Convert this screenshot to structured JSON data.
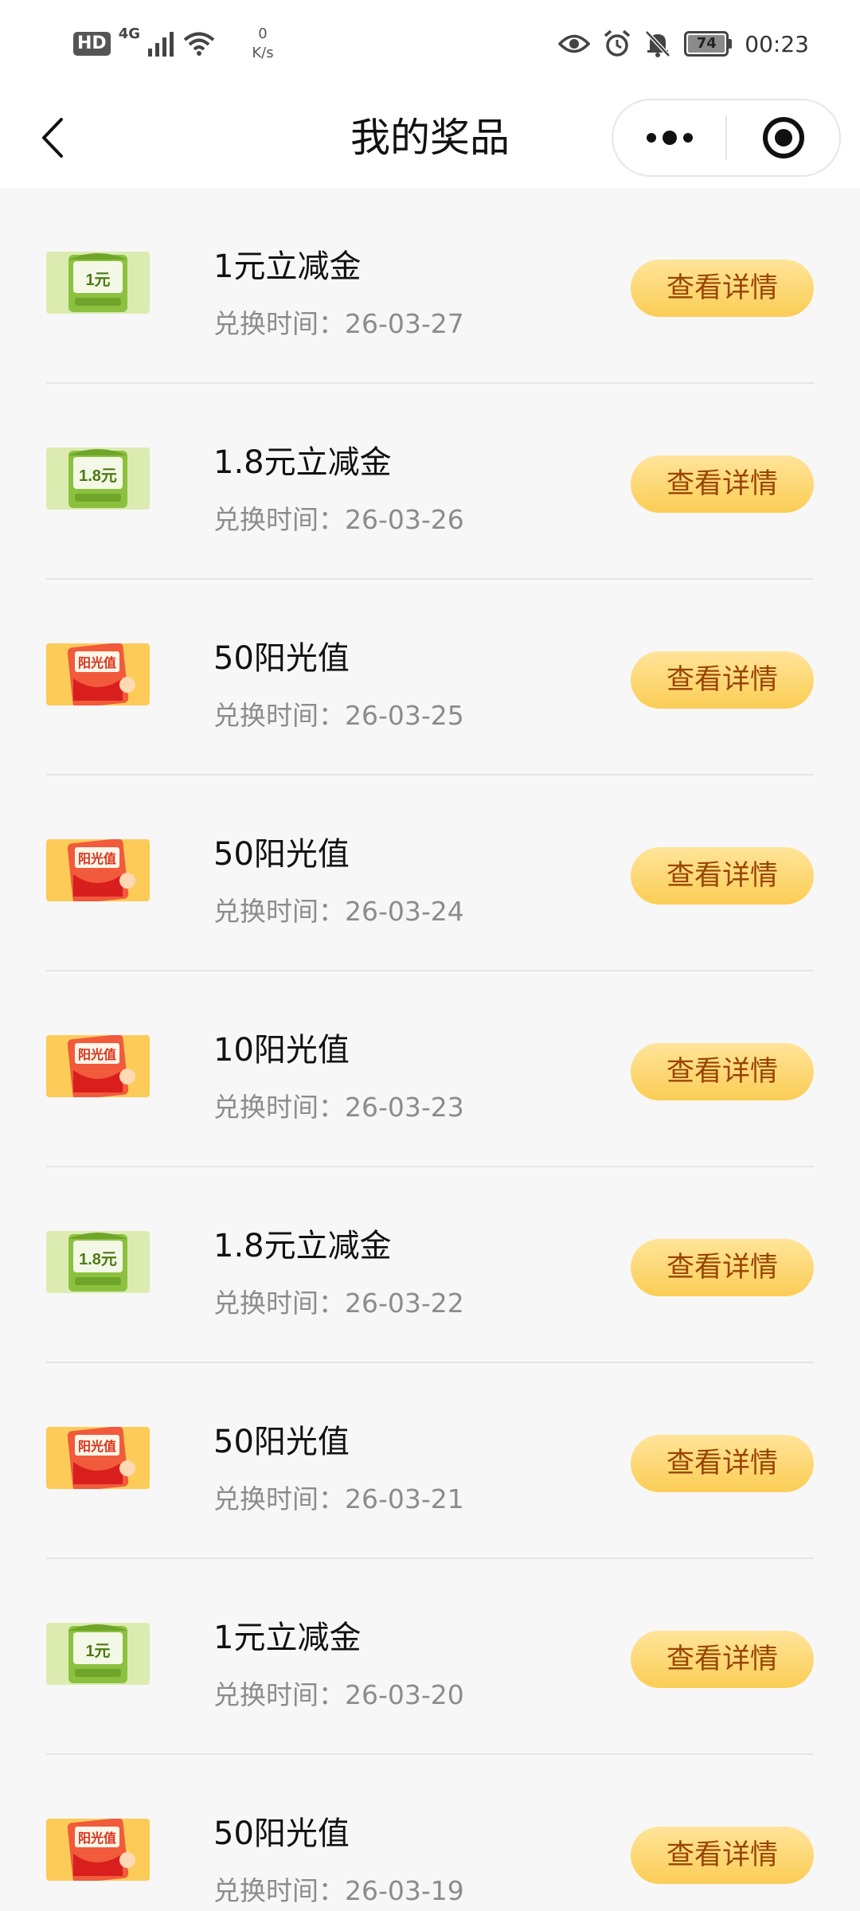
{
  "status_bar": {
    "hd": "HD",
    "network": "4G",
    "speed_value": "0",
    "speed_unit": "K/s",
    "battery": "74",
    "time": "00:23"
  },
  "header": {
    "title": "我的奖品"
  },
  "detail_label": "查看详情",
  "prizes": [
    {
      "name": "1元立减金",
      "time": "兑换时间：26-03-27",
      "icon": "green-coupon-icon",
      "badge": "1元"
    },
    {
      "name": "1.8元立减金",
      "time": "兑换时间：26-03-26",
      "icon": "green-coupon-icon",
      "badge": "1.8元"
    },
    {
      "name": "50阳光值",
      "time": "兑换时间：26-03-25",
      "icon": "red-envelope-icon",
      "badge": "阳光值"
    },
    {
      "name": "50阳光值",
      "time": "兑换时间：26-03-24",
      "icon": "red-envelope-icon",
      "badge": "阳光值"
    },
    {
      "name": "10阳光值",
      "time": "兑换时间：26-03-23",
      "icon": "red-envelope-icon",
      "badge": "阳光值"
    },
    {
      "name": "1.8元立减金",
      "time": "兑换时间：26-03-22",
      "icon": "green-coupon-icon",
      "badge": "1.8元"
    },
    {
      "name": "50阳光值",
      "time": "兑换时间：26-03-21",
      "icon": "red-envelope-icon",
      "badge": "阳光值"
    },
    {
      "name": "1元立减金",
      "time": "兑换时间：26-03-20",
      "icon": "green-coupon-icon",
      "badge": "1元"
    },
    {
      "name": "50阳光值",
      "time": "兑换时间：26-03-19",
      "icon": "red-envelope-icon",
      "badge": "阳光值"
    }
  ]
}
